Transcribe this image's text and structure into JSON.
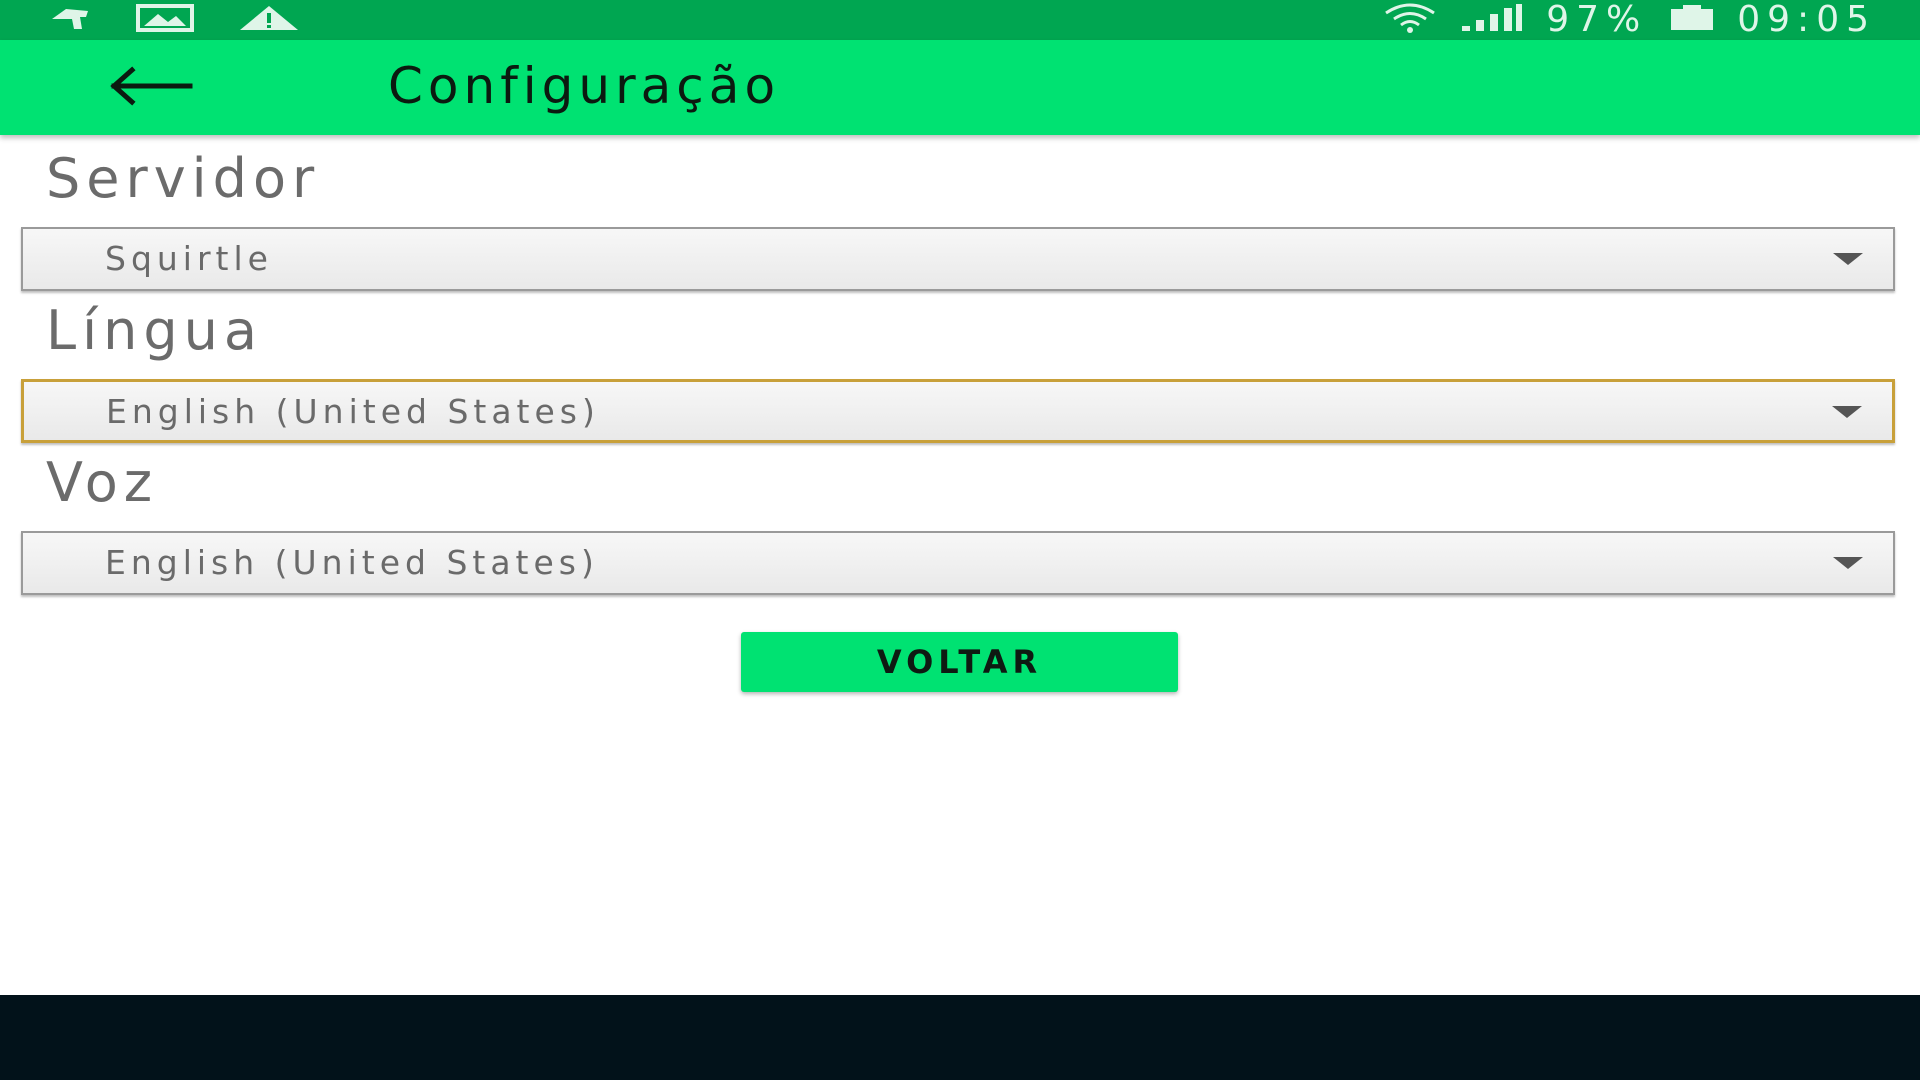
{
  "status_bar": {
    "left_icons": [
      "notification-flag-icon",
      "image-icon",
      "warning-icon"
    ],
    "right_icons": [
      "wifi-icon",
      "cell-signal-icon",
      "battery-icon"
    ],
    "battery_text": "97%",
    "time": "09:05",
    "background_color": "#00a651"
  },
  "app_bar": {
    "back_icon": "arrow-left-icon",
    "title": "Configuração",
    "background_color": "#00e272"
  },
  "form": {
    "server": {
      "label": "Servidor",
      "selected": "Squirtle"
    },
    "language": {
      "label": "Língua",
      "selected": "English (United States)",
      "focused": true
    },
    "voice": {
      "label": "Voz",
      "selected": "English (United States)"
    }
  },
  "actions": {
    "back_button_label": "VOLTAR"
  },
  "colors": {
    "accent": "#00e272",
    "focus_border": "#c8a03a",
    "nav_bar": "#02121a"
  }
}
